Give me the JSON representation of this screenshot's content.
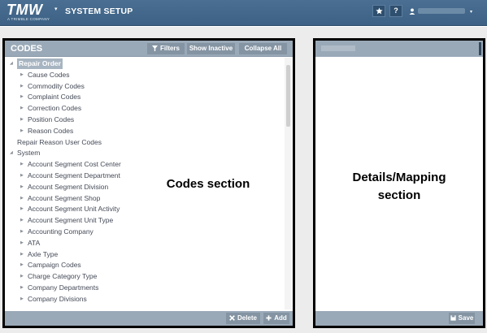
{
  "header": {
    "logo_text": "TMW",
    "logo_subtext": "A TRIMBLE COMPANY",
    "app_menu_caret": "▾",
    "title": "SYSTEM SETUP",
    "favorites_icon": "star-icon",
    "help_label": "?",
    "user_icon": "user-icon",
    "user_caret": "▾"
  },
  "codes_panel": {
    "title": "CODES",
    "filters_label": "Filters",
    "show_inactive_label": "Show Inactive",
    "collapse_all_label": "Collapse All",
    "delete_label": "Delete",
    "add_label": "Add",
    "tree": [
      {
        "label": "Repair Order",
        "level": 0,
        "expanded": true,
        "selected": true
      },
      {
        "label": "Cause Codes",
        "level": 1
      },
      {
        "label": "Commodity Codes",
        "level": 1
      },
      {
        "label": "Complaint Codes",
        "level": 1
      },
      {
        "label": "Correction Codes",
        "level": 1
      },
      {
        "label": "Position Codes",
        "level": 1
      },
      {
        "label": "Reason Codes",
        "level": 1
      },
      {
        "label": "Repair Reason User Codes",
        "level": 0,
        "leaf": true
      },
      {
        "label": "System",
        "level": 0,
        "expanded": true
      },
      {
        "label": "Account Segment Cost Center",
        "level": 1
      },
      {
        "label": "Account Segment Department",
        "level": 1
      },
      {
        "label": "Account Segment Division",
        "level": 1
      },
      {
        "label": "Account Segment Shop",
        "level": 1
      },
      {
        "label": "Account Segment Unit Activity",
        "level": 1
      },
      {
        "label": "Account Segment Unit Type",
        "level": 1
      },
      {
        "label": "Accounting Company",
        "level": 1
      },
      {
        "label": "ATA",
        "level": 1
      },
      {
        "label": "Axle Type",
        "level": 1
      },
      {
        "label": "Campaign Codes",
        "level": 1
      },
      {
        "label": "Charge Category Type",
        "level": 1
      },
      {
        "label": "Company Departments",
        "level": 1
      },
      {
        "label": "Company Divisions",
        "level": 1
      }
    ]
  },
  "details_panel": {
    "save_label": "Save"
  },
  "annotations": {
    "codes_section": "Codes section",
    "details_section_line1": "Details/Mapping",
    "details_section_line2": "section"
  },
  "colors": {
    "topbar": "#3c6184",
    "panel_header": "#9aa9b7",
    "outline": "#000000"
  }
}
